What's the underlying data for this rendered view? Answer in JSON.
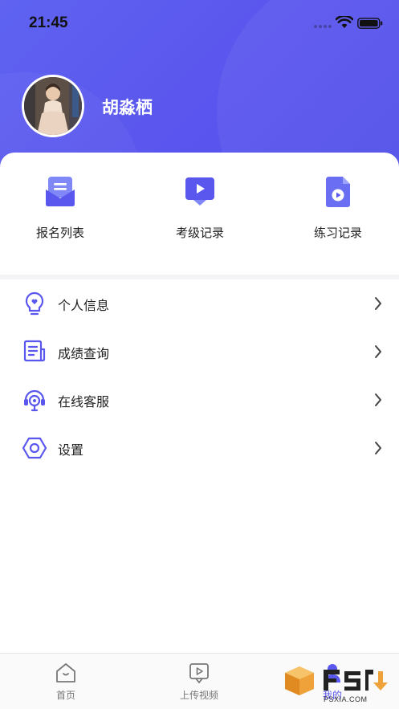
{
  "status_bar": {
    "time": "21:45"
  },
  "profile": {
    "name": "胡淼栖"
  },
  "quick_actions": [
    {
      "label": "报名列表",
      "icon": "envelope-list-icon"
    },
    {
      "label": "考级记录",
      "icon": "video-screen-icon"
    },
    {
      "label": "练习记录",
      "icon": "video-file-icon"
    }
  ],
  "menu": [
    {
      "label": "个人信息",
      "icon": "lightbulb-heart-icon"
    },
    {
      "label": "成绩查询",
      "icon": "document-list-icon"
    },
    {
      "label": "在线客服",
      "icon": "headset-service-icon"
    },
    {
      "label": "设置",
      "icon": "hexagon-settings-icon"
    }
  ],
  "tab_bar": [
    {
      "label": "首页",
      "icon": "home-icon",
      "active": false
    },
    {
      "label": "上传视频",
      "icon": "upload-video-icon",
      "active": false
    },
    {
      "label": "我的",
      "icon": "user-icon",
      "active": true
    }
  ],
  "watermark": {
    "text": "PSXIA.COM"
  },
  "colors": {
    "accent": "#5a57ee",
    "header_start": "#5f63f0",
    "header_end": "#5150e8",
    "text": "#222222"
  }
}
